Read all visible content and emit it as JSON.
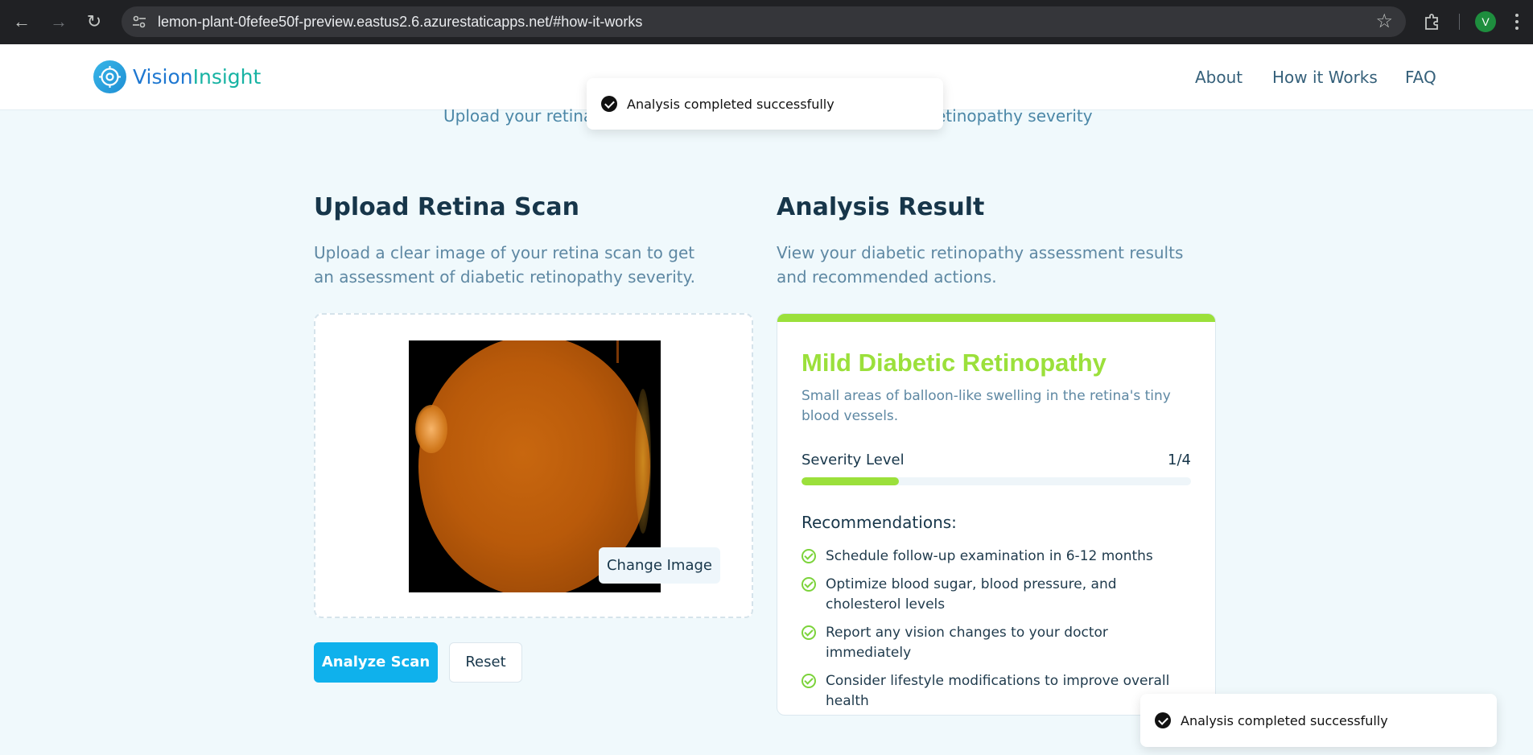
{
  "browser": {
    "url": "lemon-plant-0fefee50f-preview.eastus2.6.azurestaticapps.net/#how-it-works",
    "profile_initial": "V"
  },
  "header": {
    "logo_part1": "Vision",
    "logo_part2": "Insight",
    "nav": [
      "About",
      "How it Works",
      "FAQ"
    ]
  },
  "hero": {
    "subtitle_left": "Upload your retina",
    "subtitle_right": "etinopathy severity"
  },
  "toast_top": {
    "message": "Analysis completed successfully"
  },
  "toast_bottom": {
    "message": "Analysis completed successfully"
  },
  "upload": {
    "title": "Upload Retina Scan",
    "description": "Upload a clear image of your retina scan to get an assessment of diabetic retinopathy severity.",
    "change_image_label": "Change Image",
    "analyze_label": "Analyze Scan",
    "reset_label": "Reset"
  },
  "result": {
    "title": "Analysis Result",
    "description": "View your diabetic retinopathy assessment results and recommended actions.",
    "diagnosis": "Mild Diabetic Retinopathy",
    "diagnosis_description": "Small areas of balloon-like swelling in the retina's tiny blood vessels.",
    "severity_label": "Severity Level",
    "severity_value": "1/4",
    "severity_fraction": 0.25,
    "accent_color": "#9be03b",
    "recommendations_title": "Recommendations:",
    "recommendations": [
      "Schedule follow-up examination in 6-12 months",
      "Optimize blood sugar, blood pressure, and cholesterol levels",
      "Report any vision changes to your doctor immediately",
      "Consider lifestyle modifications to improve overall health"
    ]
  }
}
